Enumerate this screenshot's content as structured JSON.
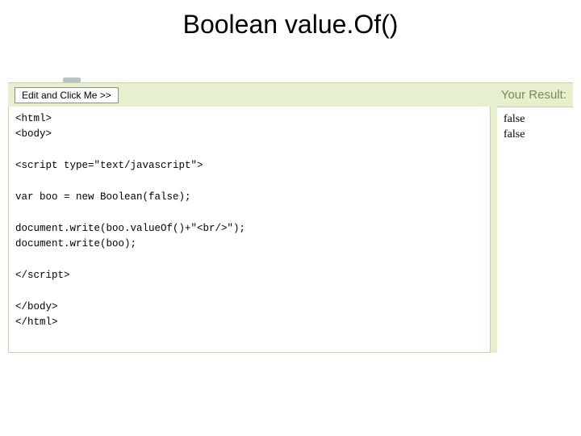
{
  "slide": {
    "title": "Boolean value.Of()"
  },
  "header": {
    "edit_button_label": "Edit and Click Me >>",
    "result_label": "Your Result:"
  },
  "code": {
    "text": "<html>\n<body>\n\n<script type=\"text/javascript\">\n\nvar boo = new Boolean(false);\n\ndocument.write(boo.valueOf()+\"<br/>\");\ndocument.write(boo);\n\n</script>\n\n</body>\n</html>"
  },
  "output": {
    "lines": [
      "false",
      "false"
    ]
  }
}
